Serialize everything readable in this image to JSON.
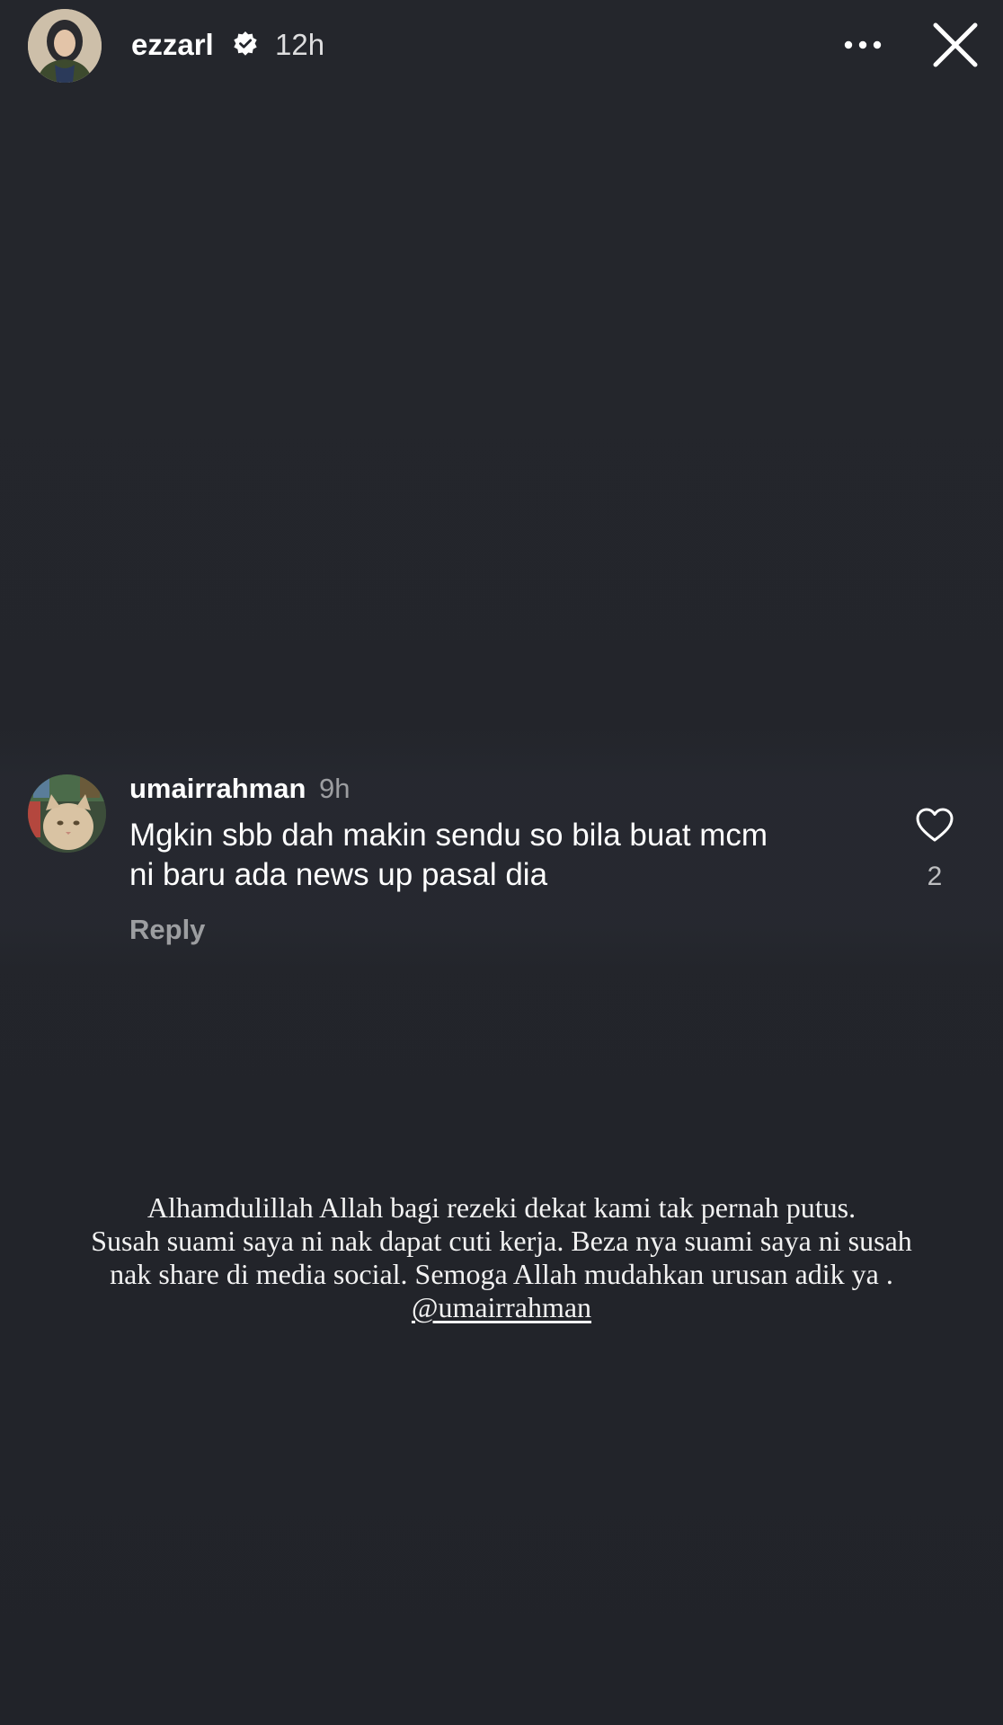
{
  "story": {
    "author": "ezzarl",
    "time": "12h"
  },
  "shared_comment": {
    "username": "umairrahman",
    "time": "9h",
    "text_line_1": "Mgkin sbb dah makin sendu so bila buat mcm",
    "text_line_2": "ni baru ada news up pasal dia",
    "reply_label": "Reply",
    "like_count": "2"
  },
  "caption": {
    "lines": [
      "Alhamdulillah Allah bagi rezeki dekat kami tak pernah putus.",
      "Susah suami saya ni nak dapat cuti kerja. Beza nya suami saya ni susah",
      "nak share di media social. Semoga Allah mudahkan urusan adik ya ."
    ],
    "mention": "@umairrahman"
  },
  "icons": {
    "verified": "verified-badge-icon",
    "more": "more-horizontal-icon",
    "close": "close-icon",
    "like": "heart-outline-icon"
  },
  "colors": {
    "background": "#23252b",
    "text_primary": "#ffffff",
    "text_muted": "#8e8f94"
  }
}
